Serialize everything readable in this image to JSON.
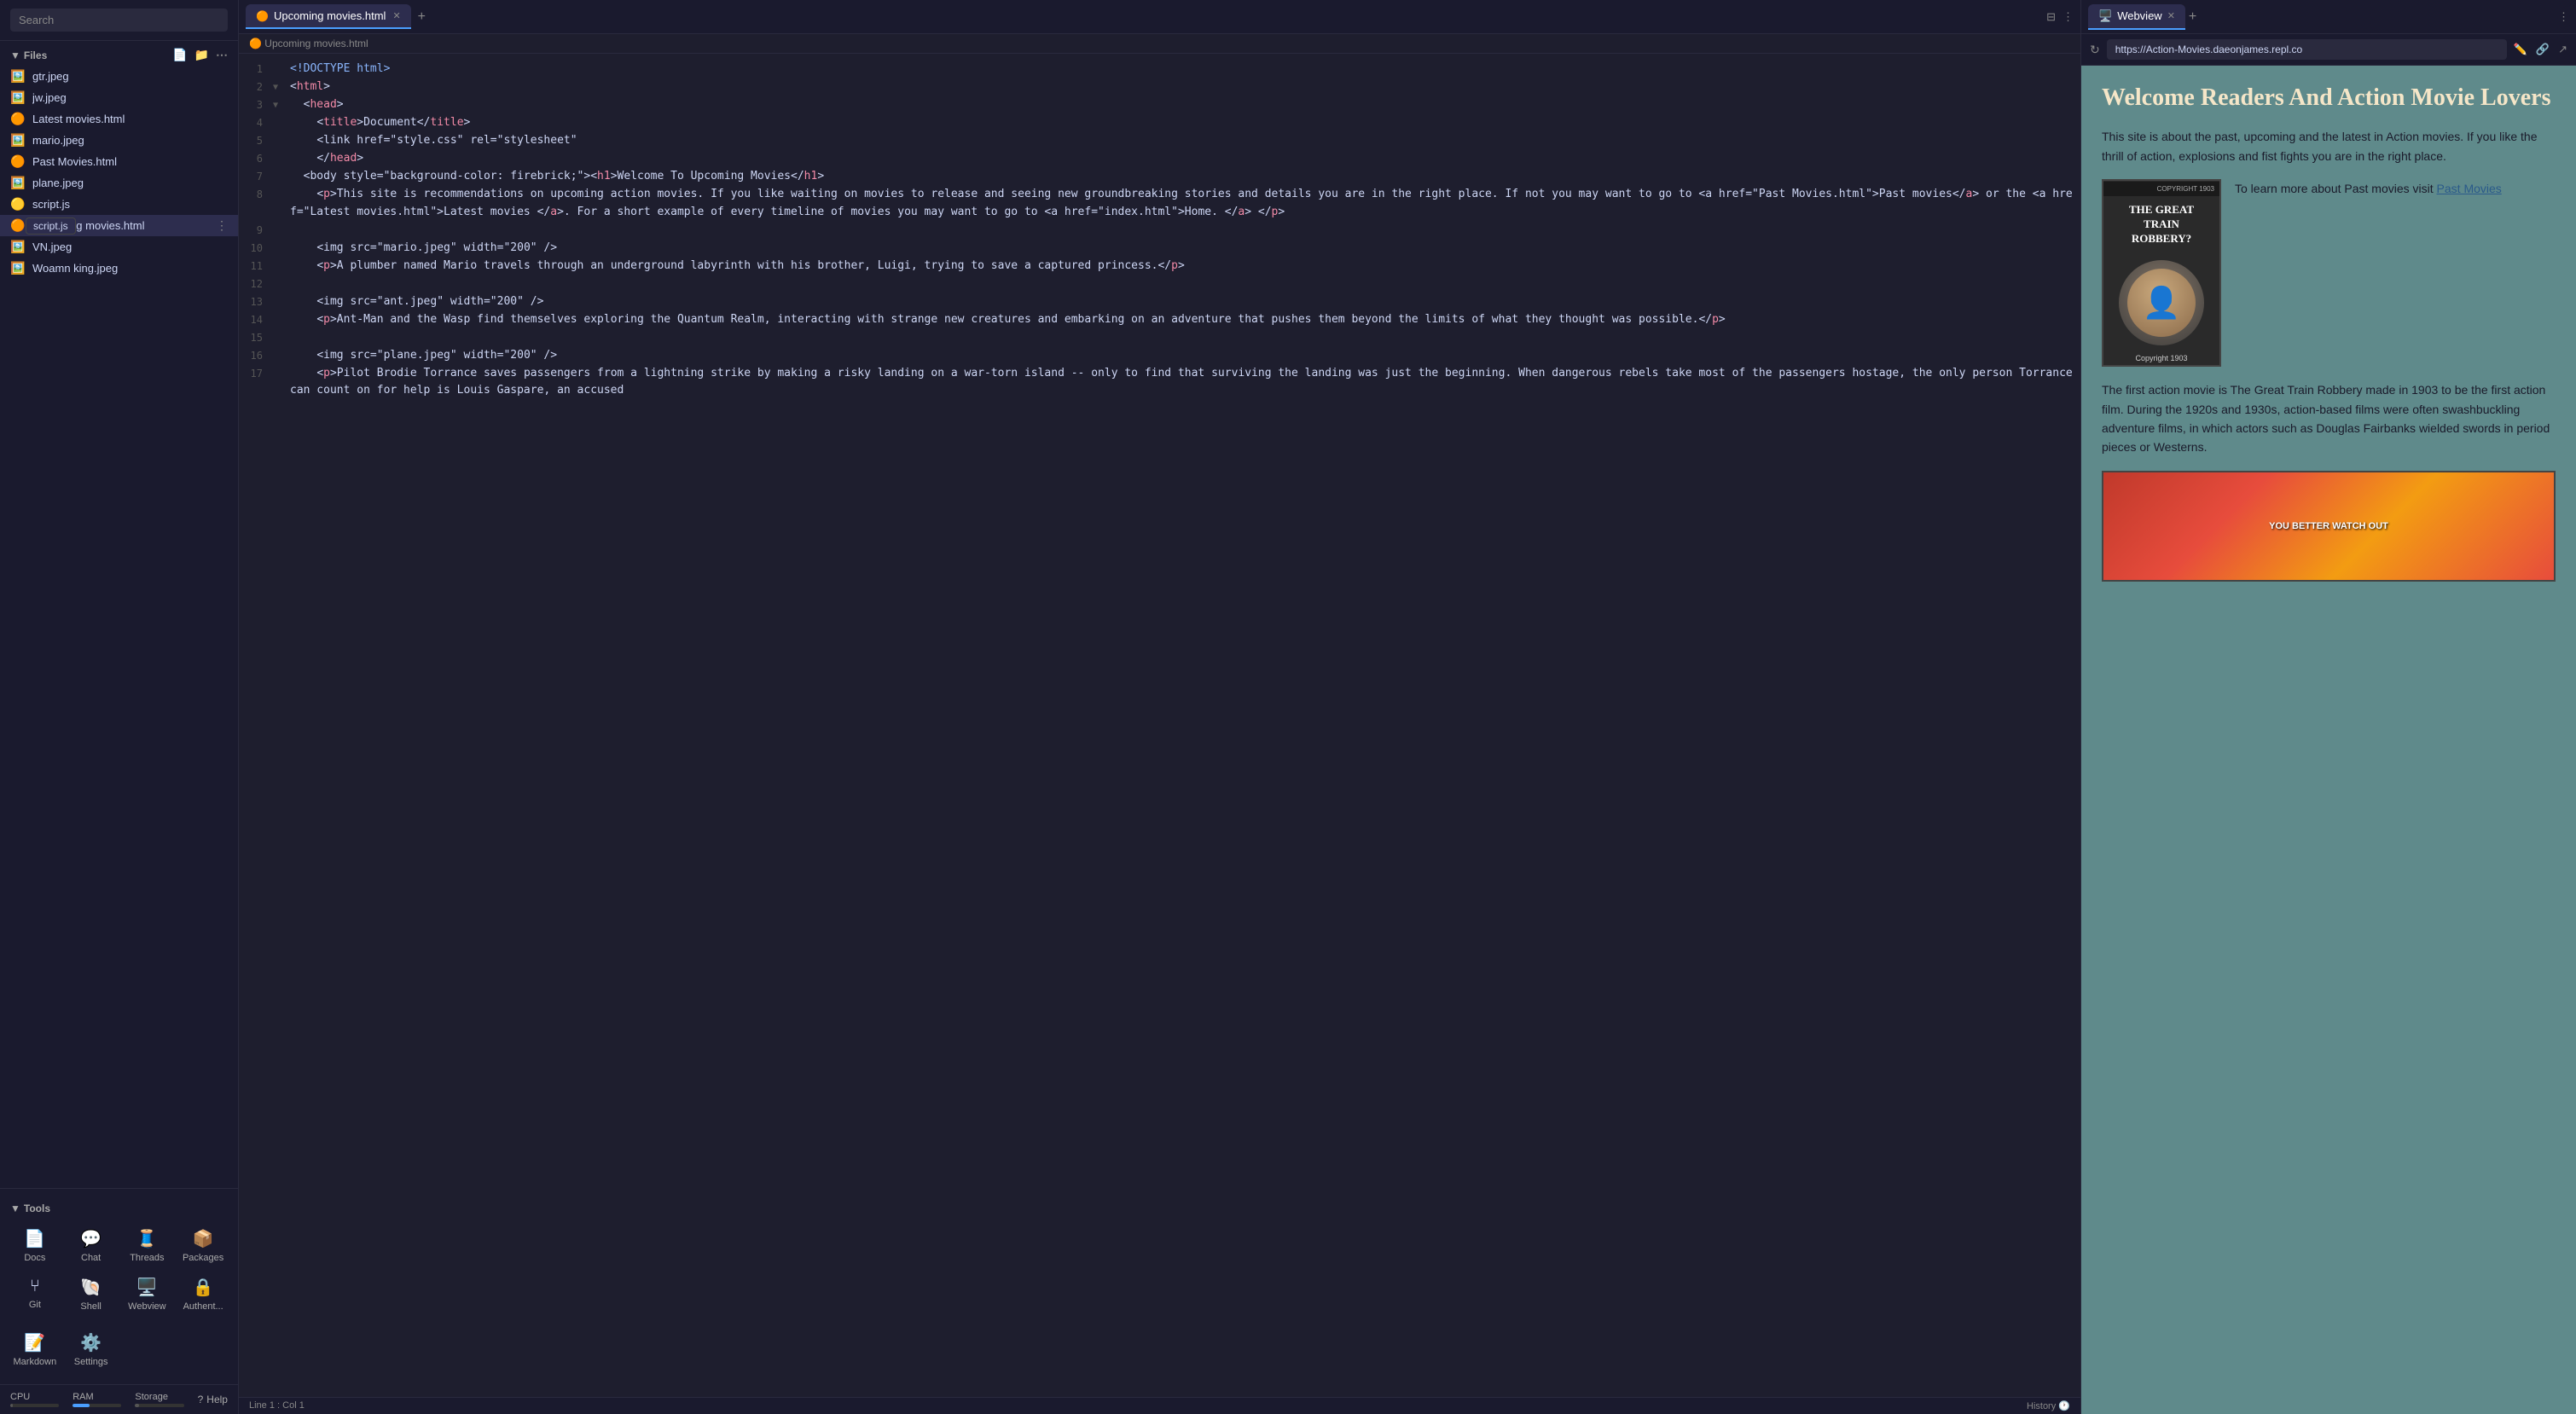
{
  "sidebar": {
    "search_placeholder": "Search",
    "files_section": "Files",
    "files": [
      {
        "name": "gtr.jpeg",
        "icon": "🖼️",
        "type": "image"
      },
      {
        "name": "jw.jpeg",
        "icon": "🖼️",
        "type": "image"
      },
      {
        "name": "Latest movies.html",
        "icon": "🟠",
        "type": "html"
      },
      {
        "name": "mario.jpeg",
        "icon": "🖼️",
        "type": "image"
      },
      {
        "name": "Past Movies.html",
        "icon": "🟠",
        "type": "html"
      },
      {
        "name": "plane.jpeg",
        "icon": "🖼️",
        "type": "image"
      },
      {
        "name": "script.js",
        "icon": "🟡",
        "type": "js",
        "active": true,
        "tooltip": "script.js"
      },
      {
        "name": "Upcoming movies.html",
        "icon": "🟠",
        "type": "html",
        "selected": true
      },
      {
        "name": "VN.jpeg",
        "icon": "🖼️",
        "type": "image"
      },
      {
        "name": "Woamn king.jpeg",
        "icon": "🖼️",
        "type": "image"
      }
    ],
    "tools_section": "Tools",
    "tools": [
      {
        "icon": "📄",
        "label": "Docs"
      },
      {
        "icon": "💬",
        "label": "Chat"
      },
      {
        "icon": "🧵",
        "label": "Threads"
      },
      {
        "icon": "📦",
        "label": "Packages"
      },
      {
        "icon": "⑂",
        "label": "Git"
      },
      {
        "icon": "🐚",
        "label": "Shell"
      },
      {
        "icon": "🖥️",
        "label": "Webview"
      },
      {
        "icon": "🔒",
        "label": "Authent..."
      }
    ],
    "tools_row2": [
      {
        "icon": "📝",
        "label": "Markdown"
      },
      {
        "icon": "⚙️",
        "label": "Settings"
      }
    ],
    "resources": {
      "cpu_label": "CPU",
      "ram_label": "RAM",
      "storage_label": "Storage"
    },
    "help_label": "Help"
  },
  "editor": {
    "tab_label": "Upcoming movies.html",
    "breadcrumb": "Upcoming movies.html",
    "status": "Line 1 : Col 1",
    "history_label": "History",
    "lines": [
      {
        "num": 1,
        "arrow": "",
        "content": "<!DOCTYPE html>"
      },
      {
        "num": 2,
        "arrow": "▼",
        "content": "<html>"
      },
      {
        "num": 3,
        "arrow": "▼",
        "content": "  <head>"
      },
      {
        "num": 4,
        "arrow": "",
        "content": "    <title>Document</title>"
      },
      {
        "num": 5,
        "arrow": "",
        "content": "    <link href=\"style.css\" rel=\"stylesheet\""
      },
      {
        "num": 6,
        "arrow": "",
        "content": "    </head>"
      },
      {
        "num": 7,
        "arrow": "",
        "content": "  <body style=\"background-color: firebrick;\"><h1>Welcome To Upcoming Movies</h1>"
      },
      {
        "num": 8,
        "arrow": "",
        "content": "    <p>This site is recommendations on upcoming action movies. If you like waiting on movies to release and seeing new groundbreaking stories and details you are in the right place. If not you may want to go to <a href=\"Past Movies.html\">Past movies</a> or the <a href=\"Latest movies.html\">Latest movies </a>. For a short example of every timeline of movies you may want to go to <a href=\"index.html\">Home. </a> </p>"
      },
      {
        "num": 9,
        "arrow": "",
        "content": ""
      },
      {
        "num": 10,
        "arrow": "",
        "content": "    <img src=\"mario.jpeg\" width=\"200\" />"
      },
      {
        "num": 11,
        "arrow": "",
        "content": "    <p>A plumber named Mario travels through an underground labyrinth with his brother, Luigi, trying to save a captured princess.</p>"
      },
      {
        "num": 12,
        "arrow": "",
        "content": ""
      },
      {
        "num": 13,
        "arrow": "",
        "content": "    <img src=\"ant.jpeg\" width=\"200\" />"
      },
      {
        "num": 14,
        "arrow": "",
        "content": "    <p>Ant-Man and the Wasp find themselves exploring the Quantum Realm, interacting with strange new creatures and embarking on an adventure that pushes them beyond the limits of what they thought was possible.</p>"
      },
      {
        "num": 15,
        "arrow": "",
        "content": ""
      },
      {
        "num": 16,
        "arrow": "",
        "content": "    <img src=\"plane.jpeg\" width=\"200\" />"
      },
      {
        "num": 17,
        "arrow": "",
        "content": "    <p>Pilot Brodie Torrance saves passengers from a lightning strike by making a risky landing on a war-torn island -- only to find that surviving the landing was just the beginning. When dangerous rebels take most of the passengers hostage, the only person Torrance can count on for help is Louis Gaspare, an accused"
      }
    ]
  },
  "webview": {
    "tab_label": "Webview",
    "url": "https://Action-Movies.daeonjames.repl.co",
    "title": "Welcome Readers And Action Movie Lovers",
    "intro": "This site is about the past, upcoming and the latest in Action movies. If you like the thrill of action, explosions and fist fights you are in the right place.",
    "poster_title": "The Great Train Robbery",
    "poster_label": "Copyright 1903",
    "visit_text_before": "To learn more about Past movies visit ",
    "past_movies_link": "Past Movies",
    "body_text": "The first action movie is The Great Train Robbery made in 1903 to be the first action film. During the 1920s and 1930s, action-based films were often swashbuckling adventure films, in which actors such as Douglas Fairbanks wielded swords in period pieces or Westerns.",
    "image2_text": "YOU BETTER WATCH OUT"
  }
}
